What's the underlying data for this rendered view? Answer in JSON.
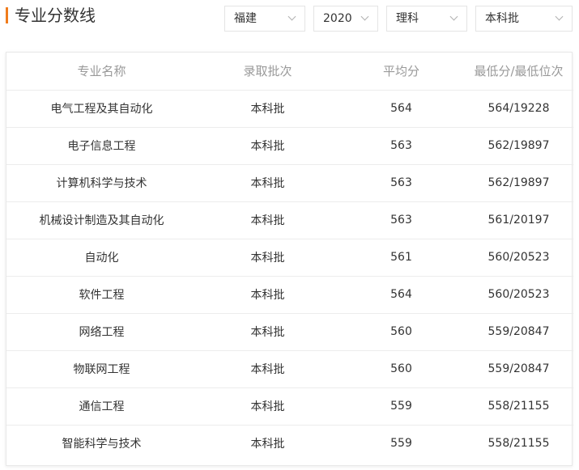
{
  "header": {
    "title": "专业分数线"
  },
  "filters": {
    "province": "福建",
    "year": "2020",
    "subject": "理科",
    "batch": "本科批"
  },
  "table": {
    "columns": [
      "专业名称",
      "录取批次",
      "平均分",
      "最低分/最低位次"
    ],
    "rows": [
      [
        "电气工程及其自动化",
        "本科批",
        "564",
        "564/19228"
      ],
      [
        "电子信息工程",
        "本科批",
        "563",
        "562/19897"
      ],
      [
        "计算机科学与技术",
        "本科批",
        "563",
        "562/19897"
      ],
      [
        "机械设计制造及其自动化",
        "本科批",
        "563",
        "561/20197"
      ],
      [
        "自动化",
        "本科批",
        "561",
        "560/20523"
      ],
      [
        "软件工程",
        "本科批",
        "564",
        "560/20523"
      ],
      [
        "网络工程",
        "本科批",
        "560",
        "559/20847"
      ],
      [
        "物联网工程",
        "本科批",
        "560",
        "559/20847"
      ],
      [
        "通信工程",
        "本科批",
        "559",
        "558/21155"
      ],
      [
        "智能科学与技术",
        "本科批",
        "559",
        "558/21155"
      ]
    ]
  },
  "colors": {
    "accent": "#f07c1c",
    "header_text": "#999999",
    "text": "#333333"
  }
}
